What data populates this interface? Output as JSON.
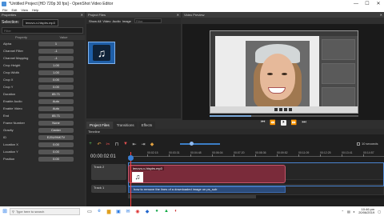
{
  "window": {
    "title": "*Untitled Project [HD 720p 30 fps] - OpenShot Video Editor",
    "min": "—",
    "max": "☐",
    "close": "✕"
  },
  "menu": {
    "items": [
      "File",
      "Edit",
      "View",
      "Help"
    ]
  },
  "properties": {
    "header": "Properties",
    "selection_label": "Selection:",
    "selection_value": "lenovo-v-hispirs.mp3",
    "filter_placeholder": "Filter",
    "col_property": "Property",
    "col_value": "Value",
    "rows": [
      {
        "name": "Alpha",
        "value": "1"
      },
      {
        "name": "Channel Filter",
        "value": "-1"
      },
      {
        "name": "Channel Mapping",
        "value": "-1"
      },
      {
        "name": "Crop Height",
        "value": "1.00"
      },
      {
        "name": "Crop Width",
        "value": "1.00"
      },
      {
        "name": "Crop X",
        "value": "0.00"
      },
      {
        "name": "Crop Y",
        "value": "0.00"
      },
      {
        "name": "Duration",
        "value": "85.71"
      },
      {
        "name": "Enable Audio",
        "value": "Auto"
      },
      {
        "name": "Enable Video",
        "value": "Auto"
      },
      {
        "name": "End",
        "value": "85.71"
      },
      {
        "name": "Frame Number",
        "value": "None"
      },
      {
        "name": "Gravity",
        "value": "Center"
      },
      {
        "name": "ID",
        "value": "EJ5U9NK7V"
      },
      {
        "name": "Location X",
        "value": "0.00"
      },
      {
        "name": "Location Y",
        "value": "0.00"
      },
      {
        "name": "Position",
        "value": "0.00"
      }
    ]
  },
  "project_files": {
    "header": "Project Files",
    "filters": [
      "Show All",
      "Video",
      "Audio",
      "Image"
    ],
    "filter_placeholder": "Filter",
    "thumb_icon": "music-note-icon"
  },
  "preview": {
    "header": "Video Preview",
    "controls": [
      "⏮",
      "⏪",
      "⏵",
      "⏩",
      "⏭"
    ],
    "progress": 0.28
  },
  "tabs": [
    "Project Files",
    "Transitions",
    "Effects"
  ],
  "timeline": {
    "header": "Timeline",
    "timecode": "00:00:02:01",
    "seconds_label": "10 seconds",
    "ruler": [
      "00:02:15",
      "00:03:31",
      "00:04:48",
      "00:06:04",
      "00:07:20",
      "00:08:36",
      "00:09:52",
      "00:11:09",
      "00:12:25",
      "00:13:41",
      "00:14:57"
    ],
    "tracks": [
      {
        "label": "Track 2"
      },
      {
        "label": "Track 1"
      }
    ],
    "clip1_title": "lenovo-v-hispirs.mp3",
    "clip2_title": "how to remove the lines of a downloaded image on ps_sub"
  },
  "taskbar": {
    "search_placeholder": "Type here to search",
    "time": "10:46 pm",
    "date": "20/06/2019"
  }
}
